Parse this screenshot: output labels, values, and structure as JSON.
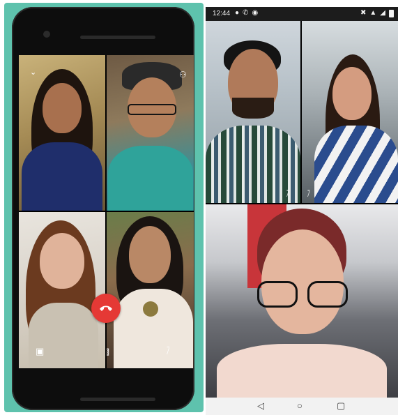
{
  "left_phone": {
    "collapse_icon": "chevron-down-icon",
    "add_participant_icon": "add-person-icon",
    "controls": {
      "camera_switch_icon": "camera-switch-icon",
      "end_call_icon": "phone-hangup-icon",
      "video_off_icon": "video-off-icon",
      "mute_icon": "microphone-off-icon"
    },
    "colors": {
      "background": "#5ec2ad",
      "end_call": "#e53935"
    }
  },
  "right_phone": {
    "status_bar": {
      "time": "12:44",
      "left_icons": [
        "chat-bubble-icon",
        "phone-icon",
        "messenger-icon"
      ],
      "right_icons": [
        "mute-icon",
        "wifi-icon",
        "signal-icon",
        "battery-icon"
      ]
    },
    "tiles": [
      {
        "muted_icon": "microphone-off-icon"
      },
      {
        "muted_icon": "microphone-off-icon"
      },
      {
        "muted_icon": null
      }
    ],
    "nav_bar": {
      "back_icon": "back-triangle-icon",
      "home_icon": "home-circle-icon",
      "recents_icon": "recents-square-icon"
    }
  }
}
